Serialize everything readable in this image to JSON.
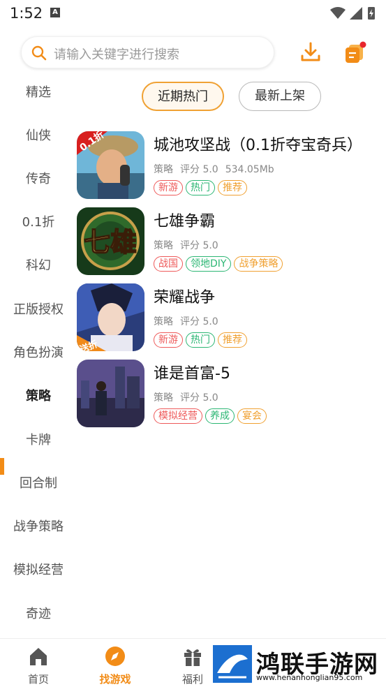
{
  "status": {
    "time": "1:52",
    "notification_letter": "A"
  },
  "search": {
    "placeholder": "请输入关键字进行搜索"
  },
  "sidebar": {
    "items": [
      {
        "label": "精选"
      },
      {
        "label": "仙侠"
      },
      {
        "label": "传奇"
      },
      {
        "label": "0.1折"
      },
      {
        "label": "科幻"
      },
      {
        "label": "正版授权"
      },
      {
        "label": "角色扮演"
      },
      {
        "label": "策略"
      },
      {
        "label": "卡牌"
      },
      {
        "label": "回合制"
      },
      {
        "label": "战争策略"
      },
      {
        "label": "模拟经营"
      },
      {
        "label": "奇迹"
      }
    ],
    "active_index": 7
  },
  "tabs": {
    "hot": "近期热门",
    "new": "最新上架"
  },
  "games": [
    {
      "title": "城池攻坚战（0.1折夺宝奇兵）",
      "category": "策略",
      "rating": "评分 5.0",
      "size": "534.05Mb",
      "icon_badge": "0.1折",
      "tags": [
        {
          "text": "新游",
          "color": "red"
        },
        {
          "text": "热门",
          "color": "green"
        },
        {
          "text": "推荐",
          "color": "orange"
        }
      ]
    },
    {
      "title": "七雄争霸",
      "category": "策略",
      "rating": "评分 5.0",
      "size": "",
      "icon_badge": "七雄",
      "tags": [
        {
          "text": "战国",
          "color": "red"
        },
        {
          "text": "领地DIY",
          "color": "green"
        },
        {
          "text": "战争策略",
          "color": "orange"
        }
      ]
    },
    {
      "title": "荣耀战争",
      "category": "策略",
      "rating": "评分 5.0",
      "size": "",
      "icon_badge": "送折",
      "tags": [
        {
          "text": "新游",
          "color": "red"
        },
        {
          "text": "热门",
          "color": "green"
        },
        {
          "text": "推荐",
          "color": "orange"
        }
      ]
    },
    {
      "title": "谁是首富-5",
      "category": "策略",
      "rating": "评分 5.0",
      "size": "",
      "icon_badge": "",
      "tags": [
        {
          "text": "模拟经营",
          "color": "red"
        },
        {
          "text": "养成",
          "color": "green"
        },
        {
          "text": "宴会",
          "color": "orange"
        }
      ]
    }
  ],
  "bottom_nav": {
    "home": "首页",
    "find": "找游戏",
    "welfare": "福利"
  },
  "watermark": {
    "name": "鸿联手游网",
    "url": "www.henanhonglian95.com"
  },
  "colors": {
    "accent": "#f28c17",
    "tag_red": "#ee5a5a",
    "tag_green": "#2bb673",
    "tag_orange": "#f0a030"
  }
}
